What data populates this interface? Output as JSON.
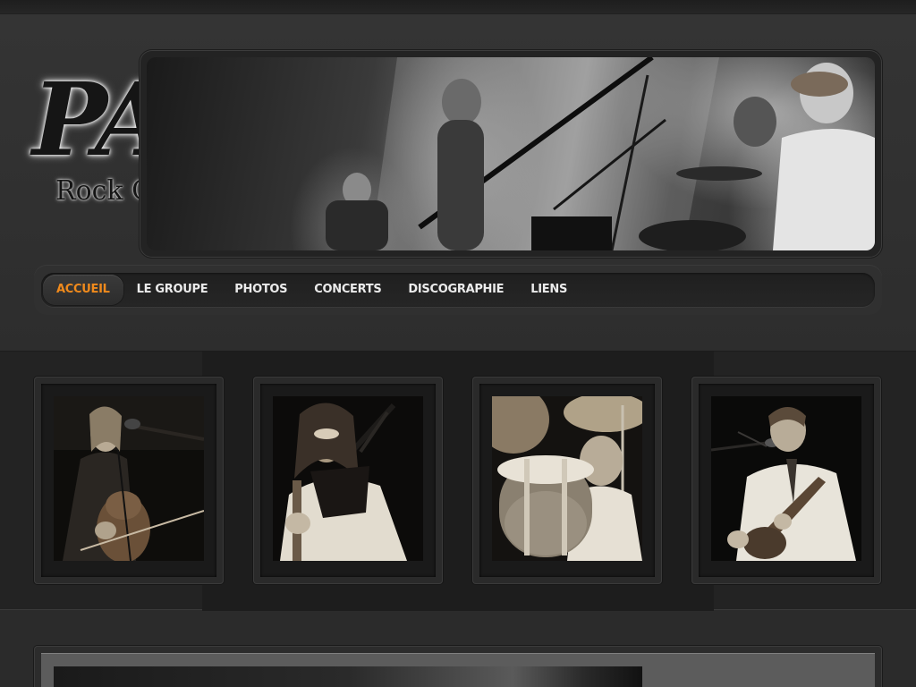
{
  "site": {
    "logo_text": "PAO",
    "tagline": "Rock Celtique"
  },
  "banner": {
    "image": "band-on-stage-photo"
  },
  "nav": {
    "items": [
      {
        "label": "ACCUEIL",
        "active": true
      },
      {
        "label": "LE GROUPE",
        "active": false
      },
      {
        "label": "PHOTOS",
        "active": false
      },
      {
        "label": "CONCERTS",
        "active": false
      },
      {
        "label": "DISCOGRAPHIE",
        "active": false
      },
      {
        "label": "LIENS",
        "active": false
      }
    ],
    "active_color": "#f08a1c"
  },
  "gallery": {
    "items": [
      {
        "subject": "cellist-photo"
      },
      {
        "subject": "bagpiper-photo"
      },
      {
        "subject": "drummer-photo"
      },
      {
        "subject": "guitarist-singer-photo"
      }
    ]
  },
  "content": {
    "image": "stage-photo"
  },
  "colors": {
    "background": "#2b2b2b",
    "accent": "#f08a1c",
    "nav_text": "#ebebeb"
  }
}
